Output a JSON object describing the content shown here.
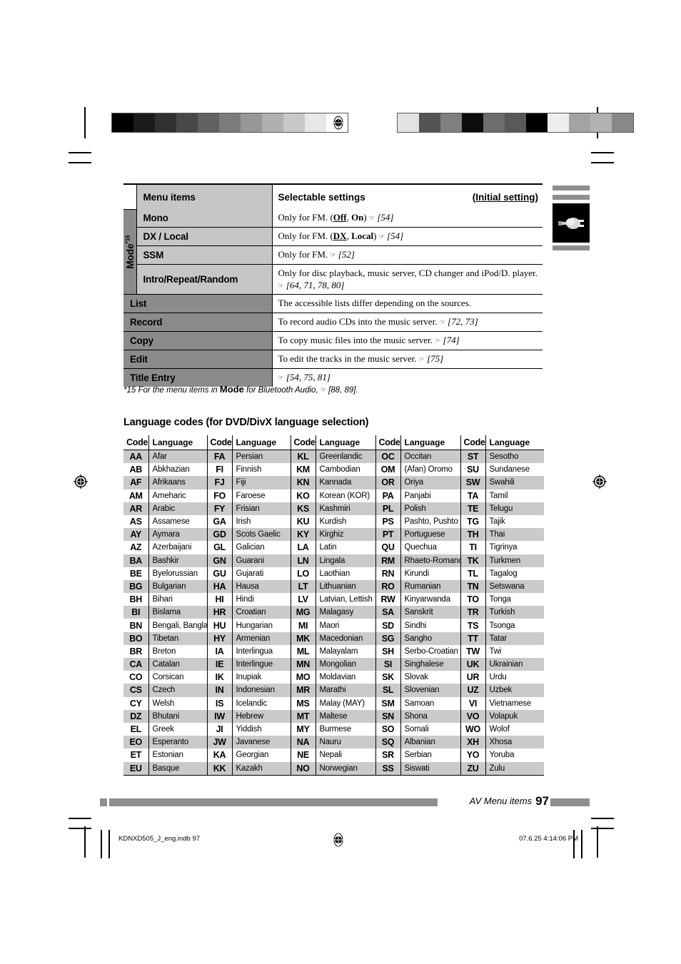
{
  "settings_table": {
    "headers": {
      "menu_items": "Menu items",
      "selectable_settings": "Selectable settings",
      "initial_setting": "(Initial setting)"
    },
    "mode_group_label": "Mode",
    "mode_group_footnote_marker": "*15",
    "rows": [
      {
        "item": "Mono",
        "setting_prefix": "Only for FM. (",
        "opt1": "Off",
        "opt_sep": ", ",
        "opt2": "On",
        "setting_suffix": ")",
        "pages": "[54]"
      },
      {
        "item": "DX / Local",
        "setting_prefix": "Only for FM. (",
        "opt1": "DX",
        "opt_sep": ", ",
        "opt2": "Local",
        "setting_suffix": ")",
        "pages": "[54]"
      },
      {
        "item": "SSM",
        "setting_prefix": "Only for FM.",
        "pages": "[52]"
      },
      {
        "item": "Intro/Repeat/Random",
        "setting_prefix": "Only for disc playback, music server, CD changer and iPod/D. player.",
        "pages": "[64, 71, 78, 80]"
      }
    ],
    "wide_rows": [
      {
        "item": "List",
        "setting": "The accessible lists differ depending on the sources.",
        "pages": ""
      },
      {
        "item": "Record",
        "setting": "To record audio CDs into the music server.",
        "pages": "[72, 73]"
      },
      {
        "item": "Copy",
        "setting": "To copy music files into the music server.",
        "pages": "[74]"
      },
      {
        "item": "Edit",
        "setting": "To edit the tracks in the music server.",
        "pages": "[75]"
      },
      {
        "item": "Title Entry",
        "setting": "",
        "pages": "[54, 75, 81]"
      }
    ]
  },
  "footnote": {
    "prefix": "*15 For the menu items in ",
    "bold": "Mode",
    "suffix": " for Bluetooth Audio, ",
    "pages": "[88, 89]."
  },
  "language_section": {
    "title": "Language codes (for DVD/DivX language selection)",
    "column_headers": {
      "code": "Code",
      "language": "Language"
    },
    "rows": [
      [
        [
          "AA",
          "Afar"
        ],
        [
          "FA",
          "Persian"
        ],
        [
          "KL",
          "Greenlandic"
        ],
        [
          "OC",
          "Occitan"
        ],
        [
          "ST",
          "Sesotho"
        ]
      ],
      [
        [
          "AB",
          "Abkhazian"
        ],
        [
          "FI",
          "Finnish"
        ],
        [
          "KM",
          "Cambodian"
        ],
        [
          "OM",
          "(Afan) Oromo"
        ],
        [
          "SU",
          "Sundanese"
        ]
      ],
      [
        [
          "AF",
          "Afrikaans"
        ],
        [
          "FJ",
          "Fiji"
        ],
        [
          "KN",
          "Kannada"
        ],
        [
          "OR",
          "Oriya"
        ],
        [
          "SW",
          "Swahili"
        ]
      ],
      [
        [
          "AM",
          "Ameharic"
        ],
        [
          "FO",
          "Faroese"
        ],
        [
          "KO",
          "Korean (KOR)"
        ],
        [
          "PA",
          "Panjabi"
        ],
        [
          "TA",
          "Tamil"
        ]
      ],
      [
        [
          "AR",
          "Arabic"
        ],
        [
          "FY",
          "Frisian"
        ],
        [
          "KS",
          "Kashmiri"
        ],
        [
          "PL",
          "Polish"
        ],
        [
          "TE",
          "Telugu"
        ]
      ],
      [
        [
          "AS",
          "Assamese"
        ],
        [
          "GA",
          "Irish"
        ],
        [
          "KU",
          "Kurdish"
        ],
        [
          "PS",
          "Pashto, Pushto"
        ],
        [
          "TG",
          "Tajik"
        ]
      ],
      [
        [
          "AY",
          "Aymara"
        ],
        [
          "GD",
          "Scots Gaelic"
        ],
        [
          "KY",
          "Kirghiz"
        ],
        [
          "PT",
          "Portuguese"
        ],
        [
          "TH",
          "Thai"
        ]
      ],
      [
        [
          "AZ",
          "Azerbaijani"
        ],
        [
          "GL",
          "Galician"
        ],
        [
          "LA",
          "Latin"
        ],
        [
          "QU",
          "Quechua"
        ],
        [
          "TI",
          "Tigrinya"
        ]
      ],
      [
        [
          "BA",
          "Bashkir"
        ],
        [
          "GN",
          "Guarani"
        ],
        [
          "LN",
          "Lingala"
        ],
        [
          "RM",
          "Rhaeto-Romance"
        ],
        [
          "TK",
          "Turkmen"
        ]
      ],
      [
        [
          "BE",
          "Byelorussian"
        ],
        [
          "GU",
          "Gujarati"
        ],
        [
          "LO",
          "Laothian"
        ],
        [
          "RN",
          "Kirundi"
        ],
        [
          "TL",
          "Tagalog"
        ]
      ],
      [
        [
          "BG",
          "Bulgarian"
        ],
        [
          "HA",
          "Hausa"
        ],
        [
          "LT",
          "Lithuanian"
        ],
        [
          "RO",
          "Rumanian"
        ],
        [
          "TN",
          "Setswana"
        ]
      ],
      [
        [
          "BH",
          "Bihari"
        ],
        [
          "HI",
          "Hindi"
        ],
        [
          "LV",
          "Latvian, Lettish"
        ],
        [
          "RW",
          "Kinyarwanda"
        ],
        [
          "TO",
          "Tonga"
        ]
      ],
      [
        [
          "BI",
          "Bislama"
        ],
        [
          "HR",
          "Croatian"
        ],
        [
          "MG",
          "Malagasy"
        ],
        [
          "SA",
          "Sanskrit"
        ],
        [
          "TR",
          "Turkish"
        ]
      ],
      [
        [
          "BN",
          "Bengali, Bangla"
        ],
        [
          "HU",
          "Hungarian"
        ],
        [
          "MI",
          "Maori"
        ],
        [
          "SD",
          "Sindhi"
        ],
        [
          "TS",
          "Tsonga"
        ]
      ],
      [
        [
          "BO",
          "Tibetan"
        ],
        [
          "HY",
          "Armenian"
        ],
        [
          "MK",
          "Macedonian"
        ],
        [
          "SG",
          "Sangho"
        ],
        [
          "TT",
          "Tatar"
        ]
      ],
      [
        [
          "BR",
          "Breton"
        ],
        [
          "IA",
          "Interlingua"
        ],
        [
          "ML",
          "Malayalam"
        ],
        [
          "SH",
          "Serbo-Croatian"
        ],
        [
          "TW",
          "Twi"
        ]
      ],
      [
        [
          "CA",
          "Catalan"
        ],
        [
          "IE",
          "Interlingue"
        ],
        [
          "MN",
          "Mongolian"
        ],
        [
          "SI",
          "Singhalese"
        ],
        [
          "UK",
          "Ukrainian"
        ]
      ],
      [
        [
          "CO",
          "Corsican"
        ],
        [
          "IK",
          "Inupiak"
        ],
        [
          "MO",
          "Moldavian"
        ],
        [
          "SK",
          "Slovak"
        ],
        [
          "UR",
          "Urdu"
        ]
      ],
      [
        [
          "CS",
          "Czech"
        ],
        [
          "IN",
          "Indonesian"
        ],
        [
          "MR",
          "Marathi"
        ],
        [
          "SL",
          "Slovenian"
        ],
        [
          "UZ",
          "Uzbek"
        ]
      ],
      [
        [
          "CY",
          "Welsh"
        ],
        [
          "IS",
          "Icelandic"
        ],
        [
          "MS",
          "Malay (MAY)"
        ],
        [
          "SM",
          "Samoan"
        ],
        [
          "VI",
          "Vietnamese"
        ]
      ],
      [
        [
          "DZ",
          "Bhutani"
        ],
        [
          "IW",
          "Hebrew"
        ],
        [
          "MT",
          "Maltese"
        ],
        [
          "SN",
          "Shona"
        ],
        [
          "VO",
          "Volapuk"
        ]
      ],
      [
        [
          "EL",
          "Greek"
        ],
        [
          "JI",
          "Yiddish"
        ],
        [
          "MY",
          "Burmese"
        ],
        [
          "SO",
          "Somali"
        ],
        [
          "WO",
          "Wolof"
        ]
      ],
      [
        [
          "EO",
          "Esperanto"
        ],
        [
          "JW",
          "Javanese"
        ],
        [
          "NA",
          "Nauru"
        ],
        [
          "SQ",
          "Albanian"
        ],
        [
          "XH",
          "Xhosa"
        ]
      ],
      [
        [
          "ET",
          "Estonian"
        ],
        [
          "KA",
          "Georgian"
        ],
        [
          "NE",
          "Nepali"
        ],
        [
          "SR",
          "Serbian"
        ],
        [
          "YO",
          "Yoruba"
        ]
      ],
      [
        [
          "EU",
          "Basque"
        ],
        [
          "KK",
          "Kazakh"
        ],
        [
          "NO",
          "Norwegian"
        ],
        [
          "SS",
          "Siswati"
        ],
        [
          "ZU",
          "Zulu"
        ]
      ]
    ]
  },
  "footer": {
    "running_head": "AV Menu items",
    "page_number": "97",
    "file_label": "KDNXD505_J_eng.indb  97",
    "timestamp": "07.6.25   4:14:06 PM"
  },
  "colors": {
    "header_gray": "#c6c6c6",
    "dark_gray": "#8b8b8b",
    "row_shade": "#cacaca",
    "rule": "#000000",
    "footer_bar": "#8e8e8e"
  }
}
